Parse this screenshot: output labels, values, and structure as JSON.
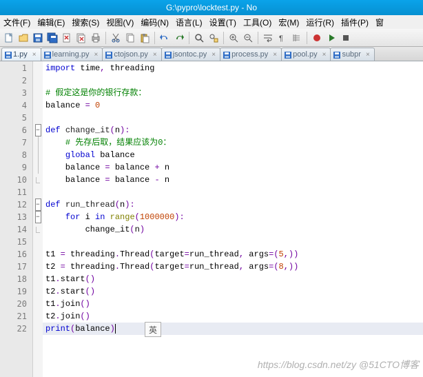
{
  "title": "G:\\pypro\\locktest.py - No",
  "menu": [
    "文件(F)",
    "编辑(E)",
    "搜索(S)",
    "视图(V)",
    "编码(N)",
    "语言(L)",
    "设置(T)",
    "工具(O)",
    "宏(M)",
    "运行(R)",
    "插件(P)",
    "窗"
  ],
  "tabs": [
    {
      "label": "1.py"
    },
    {
      "label": "learning.py"
    },
    {
      "label": "ctojson.py"
    },
    {
      "label": "jsontoc.py"
    },
    {
      "label": "process.py"
    },
    {
      "label": "pool.py"
    },
    {
      "label": "subpr"
    }
  ],
  "lines": {
    "1": [
      [
        "kw",
        "import"
      ],
      [
        "",
        " time"
      ],
      [
        "op",
        ","
      ],
      [
        "",
        " threading"
      ]
    ],
    "2": [],
    "3": [
      [
        "cmt",
        "# 假定这是你的银行存款："
      ]
    ],
    "4": [
      [
        "",
        "balance "
      ],
      [
        "op",
        "="
      ],
      [
        "",
        " "
      ],
      [
        "num",
        "0"
      ]
    ],
    "5": [],
    "6": [
      [
        "kw",
        "def"
      ],
      [
        "",
        " "
      ],
      [
        "defname",
        "change_it"
      ],
      [
        "op",
        "("
      ],
      [
        "",
        "n"
      ],
      [
        "op",
        ")"
      ],
      [
        "op",
        ":"
      ]
    ],
    "7": [
      [
        "",
        "    "
      ],
      [
        "cmt",
        "# 先存后取，结果应该为0："
      ]
    ],
    "8": [
      [
        "",
        "    "
      ],
      [
        "kw",
        "global"
      ],
      [
        "",
        " balance"
      ]
    ],
    "9": [
      [
        "",
        "    balance "
      ],
      [
        "op",
        "="
      ],
      [
        "",
        " balance "
      ],
      [
        "op",
        "+"
      ],
      [
        "",
        " n"
      ]
    ],
    "10": [
      [
        "",
        "    balance "
      ],
      [
        "op",
        "="
      ],
      [
        "",
        " balance "
      ],
      [
        "op",
        "-"
      ],
      [
        "",
        " n"
      ]
    ],
    "11": [],
    "12": [
      [
        "kw",
        "def"
      ],
      [
        "",
        " "
      ],
      [
        "defname",
        "run_thread"
      ],
      [
        "op",
        "("
      ],
      [
        "",
        "n"
      ],
      [
        "op",
        ")"
      ],
      [
        "op",
        ":"
      ]
    ],
    "13": [
      [
        "",
        "    "
      ],
      [
        "kw",
        "for"
      ],
      [
        "",
        " i "
      ],
      [
        "kw",
        "in"
      ],
      [
        "",
        " "
      ],
      [
        "fn",
        "range"
      ],
      [
        "op",
        "("
      ],
      [
        "num",
        "1000000"
      ],
      [
        "op",
        ")"
      ],
      [
        "op",
        ":"
      ]
    ],
    "14": [
      [
        "",
        "        change_it"
      ],
      [
        "op",
        "("
      ],
      [
        "",
        "n"
      ],
      [
        "op",
        ")"
      ]
    ],
    "15": [],
    "16": [
      [
        "",
        "t1 "
      ],
      [
        "op",
        "="
      ],
      [
        "",
        " threading"
      ],
      [
        "op",
        "."
      ],
      [
        "",
        "Thread"
      ],
      [
        "op",
        "("
      ],
      [
        "",
        "target"
      ],
      [
        "op",
        "="
      ],
      [
        "",
        "run_thread"
      ],
      [
        "op",
        ","
      ],
      [
        "",
        " args"
      ],
      [
        "op",
        "="
      ],
      [
        "op",
        "("
      ],
      [
        "num",
        "5"
      ],
      [
        "op",
        ","
      ],
      [
        "op",
        ")"
      ],
      [
        "op",
        ")"
      ]
    ],
    "17": [
      [
        "",
        "t2 "
      ],
      [
        "op",
        "="
      ],
      [
        "",
        " threading"
      ],
      [
        "op",
        "."
      ],
      [
        "",
        "Thread"
      ],
      [
        "op",
        "("
      ],
      [
        "",
        "target"
      ],
      [
        "op",
        "="
      ],
      [
        "",
        "run_thread"
      ],
      [
        "op",
        ","
      ],
      [
        "",
        " args"
      ],
      [
        "op",
        "="
      ],
      [
        "op",
        "("
      ],
      [
        "num",
        "8"
      ],
      [
        "op",
        ","
      ],
      [
        "op",
        ")"
      ],
      [
        "op",
        ")"
      ]
    ],
    "18": [
      [
        "",
        "t1"
      ],
      [
        "op",
        "."
      ],
      [
        "",
        "start"
      ],
      [
        "op",
        "("
      ],
      [
        "op",
        ")"
      ]
    ],
    "19": [
      [
        "",
        "t2"
      ],
      [
        "op",
        "."
      ],
      [
        "",
        "start"
      ],
      [
        "op",
        "("
      ],
      [
        "op",
        ")"
      ]
    ],
    "20": [
      [
        "",
        "t1"
      ],
      [
        "op",
        "."
      ],
      [
        "",
        "join"
      ],
      [
        "op",
        "("
      ],
      [
        "op",
        ")"
      ]
    ],
    "21": [
      [
        "",
        "t2"
      ],
      [
        "op",
        "."
      ],
      [
        "",
        "join"
      ],
      [
        "op",
        "("
      ],
      [
        "op",
        ")"
      ]
    ],
    "22": [
      [
        "kw",
        "print"
      ],
      [
        "op",
        "("
      ],
      [
        "",
        "balance"
      ],
      [
        "op",
        ")"
      ]
    ]
  },
  "fold_markers": {
    "6": "box",
    "7": "line",
    "8": "line",
    "9": "line",
    "10": "end",
    "12": "box",
    "13": "box-inner",
    "14": "end"
  },
  "current_line": 22,
  "line_count": 22,
  "ime": "英",
  "watermark": "https://blog.csdn.net/zy @51CTO博客"
}
